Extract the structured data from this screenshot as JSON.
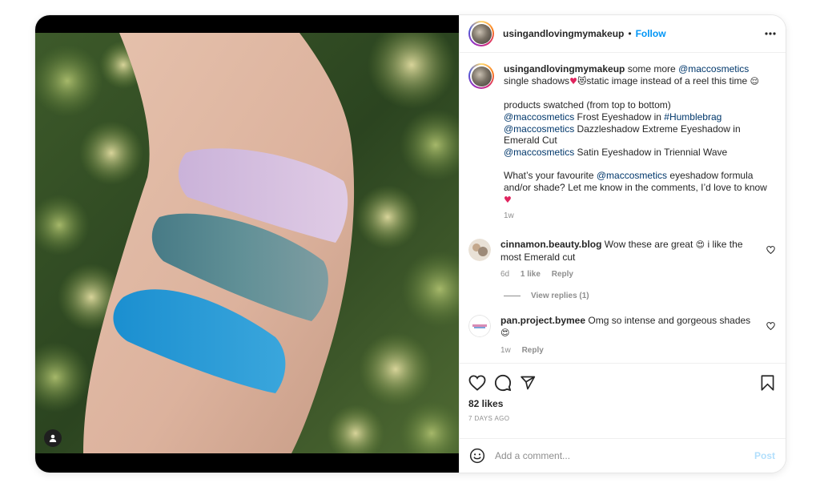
{
  "post": {
    "username": "usingandlovingmymakeup",
    "follow_label": "Follow",
    "separator": "•"
  },
  "caption": {
    "username": "usingandlovingmymakeup",
    "line1_text": "some more",
    "mention_mac": "@maccosmetics",
    "line2_text": "single shadows",
    "emoji_a": "♥",
    "line2_text_b": "static image instead of a reel this time",
    "intro": "products swatched (from top to bottom)",
    "item1_brand": "@maccosmetics",
    "item1_text": "Frost Eyeshadow in",
    "item1_tag": "#Humblebrag",
    "item2_brand": "@maccosmetics",
    "item2_text": "Dazzleshadow Extreme Eyeshadow in Emerald Cut",
    "item3_brand": "@maccosmetics",
    "item3_text": "Satin Eyeshadow in Triennial Wave",
    "question_a": "What’s your favourite",
    "question_mention": "@maccosmetics",
    "question_b": "eyeshadow formula and/or shade? Let me know in the comments, I’d love to know",
    "time": "1w"
  },
  "comments": [
    {
      "username": "cinnamon.beauty.blog",
      "text_a": "Wow these are great",
      "text_b": "i like the most Emerald cut",
      "time": "6d",
      "likes": "1 like",
      "reply": "Reply",
      "view_replies": "View replies (1)"
    },
    {
      "username": "pan.project.bymee",
      "text_a": "Omg so intense and gorgeous shades",
      "time": "1w",
      "reply": "Reply"
    }
  ],
  "footer": {
    "likes": "82 likes",
    "time_ago": "7 DAYS AGO",
    "comment_placeholder": "Add a comment...",
    "post_label": "Post"
  },
  "icons": {
    "more": "more-horizontal-icon",
    "heart": "heart-icon",
    "comment": "comment-icon",
    "share": "share-icon",
    "save": "bookmark-icon",
    "emoji": "emoji-icon",
    "user_tag": "user-tag-icon"
  },
  "colors": {
    "link": "#00376b",
    "follow": "#0095f6",
    "muted": "#8e8e8e",
    "post_disabled": "#b2dffc"
  }
}
